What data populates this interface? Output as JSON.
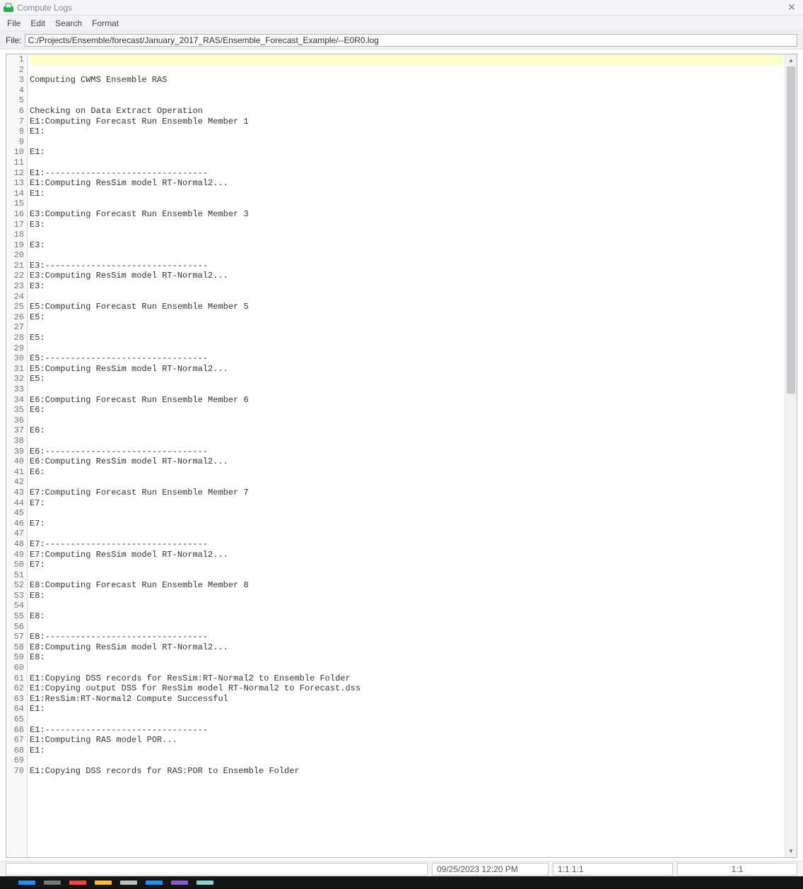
{
  "window": {
    "title": "Compute Logs",
    "close": "✕"
  },
  "menu": {
    "file": "File",
    "edit": "Edit",
    "search": "Search",
    "format": "Format"
  },
  "file_row": {
    "label": "File: ",
    "path": "C:/Projects/Ensemble/forecast/January_2017_RAS/Ensemble_Forecast_Example/--E0R0.log"
  },
  "lines": [
    {
      "n": 1,
      "t": "",
      "hl": true
    },
    {
      "n": 2,
      "t": ""
    },
    {
      "n": 3,
      "t": "Computing CWMS Ensemble RAS"
    },
    {
      "n": 4,
      "t": ""
    },
    {
      "n": 5,
      "t": ""
    },
    {
      "n": 6,
      "t": "Checking on Data Extract Operation"
    },
    {
      "n": 7,
      "t": "E1:Computing Forecast Run Ensemble Member 1"
    },
    {
      "n": 8,
      "t": "E1:"
    },
    {
      "n": 9,
      "t": ""
    },
    {
      "n": 10,
      "t": "E1:"
    },
    {
      "n": 11,
      "t": ""
    },
    {
      "n": 12,
      "t": "E1:--------------------------------"
    },
    {
      "n": 13,
      "t": "E1:Computing ResSim model RT-Normal2..."
    },
    {
      "n": 14,
      "t": "E1:"
    },
    {
      "n": 15,
      "t": ""
    },
    {
      "n": 16,
      "t": "E3:Computing Forecast Run Ensemble Member 3"
    },
    {
      "n": 17,
      "t": "E3:"
    },
    {
      "n": 18,
      "t": ""
    },
    {
      "n": 19,
      "t": "E3:"
    },
    {
      "n": 20,
      "t": ""
    },
    {
      "n": 21,
      "t": "E3:--------------------------------"
    },
    {
      "n": 22,
      "t": "E3:Computing ResSim model RT-Normal2..."
    },
    {
      "n": 23,
      "t": "E3:"
    },
    {
      "n": 24,
      "t": ""
    },
    {
      "n": 25,
      "t": "E5:Computing Forecast Run Ensemble Member 5"
    },
    {
      "n": 26,
      "t": "E5:"
    },
    {
      "n": 27,
      "t": ""
    },
    {
      "n": 28,
      "t": "E5:"
    },
    {
      "n": 29,
      "t": ""
    },
    {
      "n": 30,
      "t": "E5:--------------------------------"
    },
    {
      "n": 31,
      "t": "E5:Computing ResSim model RT-Normal2..."
    },
    {
      "n": 32,
      "t": "E5:"
    },
    {
      "n": 33,
      "t": ""
    },
    {
      "n": 34,
      "t": "E6:Computing Forecast Run Ensemble Member 6"
    },
    {
      "n": 35,
      "t": "E6:"
    },
    {
      "n": 36,
      "t": ""
    },
    {
      "n": 37,
      "t": "E6:"
    },
    {
      "n": 38,
      "t": ""
    },
    {
      "n": 39,
      "t": "E6:--------------------------------"
    },
    {
      "n": 40,
      "t": "E6:Computing ResSim model RT-Normal2..."
    },
    {
      "n": 41,
      "t": "E6:"
    },
    {
      "n": 42,
      "t": ""
    },
    {
      "n": 43,
      "t": "E7:Computing Forecast Run Ensemble Member 7"
    },
    {
      "n": 44,
      "t": "E7:"
    },
    {
      "n": 45,
      "t": ""
    },
    {
      "n": 46,
      "t": "E7:"
    },
    {
      "n": 47,
      "t": ""
    },
    {
      "n": 48,
      "t": "E7:--------------------------------"
    },
    {
      "n": 49,
      "t": "E7:Computing ResSim model RT-Normal2..."
    },
    {
      "n": 50,
      "t": "E7:"
    },
    {
      "n": 51,
      "t": ""
    },
    {
      "n": 52,
      "t": "E8:Computing Forecast Run Ensemble Member 8"
    },
    {
      "n": 53,
      "t": "E8:"
    },
    {
      "n": 54,
      "t": ""
    },
    {
      "n": 55,
      "t": "E8:"
    },
    {
      "n": 56,
      "t": ""
    },
    {
      "n": 57,
      "t": "E8:--------------------------------"
    },
    {
      "n": 58,
      "t": "E8:Computing ResSim model RT-Normal2..."
    },
    {
      "n": 59,
      "t": "E8:"
    },
    {
      "n": 60,
      "t": ""
    },
    {
      "n": 61,
      "t": "E1:Copying DSS records for ResSim:RT-Normal2 to Ensemble Folder"
    },
    {
      "n": 62,
      "t": "E1:Copying output DSS for ResSim model RT-Normal2 to Forecast.dss"
    },
    {
      "n": 63,
      "t": "E1:ResSim:RT-Normal2 Compute Successful"
    },
    {
      "n": 64,
      "t": "E1:"
    },
    {
      "n": 65,
      "t": ""
    },
    {
      "n": 66,
      "t": "E1:--------------------------------"
    },
    {
      "n": 67,
      "t": "E1:Computing RAS model POR..."
    },
    {
      "n": 68,
      "t": "E1:"
    },
    {
      "n": 69,
      "t": ""
    },
    {
      "n": 70,
      "t": "E1:Copying DSS records for RAS:POR to Ensemble Folder"
    }
  ],
  "status": {
    "left": "",
    "datetime": "09/25/2023 12:20 PM",
    "pos_a": "1:1 1:1",
    "pos_b": "1:1"
  },
  "scroll": {
    "up": "▴",
    "down": "▾"
  },
  "taskbar_colors": [
    "#1e90ff",
    "#777",
    "#ff4040",
    "#ffbb33",
    "#c0c0c0",
    "#1e90ff",
    "#8a5bcc",
    "#8ed2cf"
  ]
}
